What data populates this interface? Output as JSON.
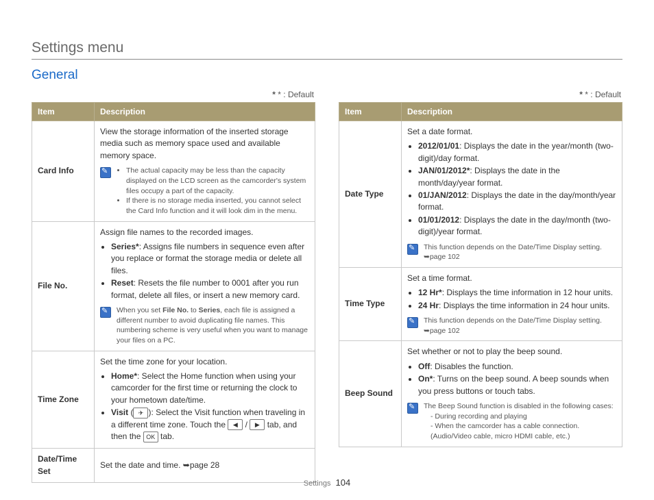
{
  "title": "Settings menu",
  "section": "General",
  "default_note": "* : Default",
  "footer": {
    "section": "Settings",
    "page": "104"
  },
  "headers": {
    "item": "Item",
    "desc": "Description"
  },
  "icons": {
    "visit": "✈",
    "left": "◀",
    "right": "▶",
    "ok": "OK",
    "ref": "➥"
  },
  "left": [
    {
      "item": "Card Info",
      "intro": "View the storage information of the inserted storage media such as memory space used and available memory space.",
      "note_list": [
        "The actual capacity may be less than the capacity displayed on the LCD screen as the camcorder's system files occupy a part of the capacity.",
        "If there is no storage media inserted, you cannot select the Card Info function and it will look dim in the menu."
      ]
    },
    {
      "item": "File No.",
      "intro": "Assign file names to the recorded images.",
      "bullets": [
        {
          "label": "Series*",
          "text": ": Assigns file numbers in sequence even after you replace or format the storage media or delete all files."
        },
        {
          "label": "Reset",
          "text": ": Resets the file number to 0001 after you run format, delete all files, or insert a new memory card."
        }
      ],
      "note": "When you set File No. to Series, each file is assigned a different number to avoid duplicating file names. This numbering scheme is very useful when you want to manage your files on a PC.",
      "note_bold1": "File No.",
      "note_bold2": "Series"
    },
    {
      "item": "Time Zone",
      "intro": "Set the time zone for your location.",
      "bullets": [
        {
          "label": "Home*",
          "text": ": Select the Home function when using your camcorder for the first time or returning the clock to your hometown date/time."
        },
        {
          "label": "Visit",
          "text_pre": " (",
          "text_post": "): Select the Visit function when traveling in a different time zone. Touch the ",
          "text_mid": " / ",
          "text_tab": " tab, and then the ",
          "text_end": " tab."
        }
      ]
    },
    {
      "item": "Date/Time Set",
      "intro": "Set the date and time. ",
      "ref": "page 28"
    }
  ],
  "right": [
    {
      "item": "Date Type",
      "intro": "Set a date format.",
      "bullets": [
        {
          "label": "2012/01/01",
          "text": ": Displays the date in the year/month (two-digit)/day format."
        },
        {
          "label": "JAN/01/2012*",
          "text": ": Displays the date in the month/day/year format."
        },
        {
          "label": "01/JAN/2012",
          "text": ": Displays the date in the day/month/year format."
        },
        {
          "label": "01/01/2012",
          "text": ": Displays the date in the day/month (two-digit)/year format."
        }
      ],
      "note": "This function depends on the Date/Time Display setting.",
      "note_ref": "page 102"
    },
    {
      "item": "Time Type",
      "intro": "Set a time format.",
      "bullets": [
        {
          "label": "12 Hr*",
          "text": ": Displays the time information in 12 hour units."
        },
        {
          "label": "24 Hr",
          "text": ": Displays the time information in 24 hour units."
        }
      ],
      "note": "This function depends on the Date/Time Display setting.",
      "note_ref": "page 102"
    },
    {
      "item": "Beep Sound",
      "intro": "Set whether or not to play the beep sound.",
      "bullets": [
        {
          "label": "Off",
          "text": ": Disables the function."
        },
        {
          "label": "On*",
          "text": ": Turns on the beep sound. A beep sounds when you press buttons or touch tabs."
        }
      ],
      "note": "The Beep Sound function is disabled in the following cases:",
      "note_sub": [
        "- During recording and playing",
        "- When the camcorder has a cable connection. (Audio/Video cable, micro HDMI cable, etc.)"
      ]
    }
  ]
}
